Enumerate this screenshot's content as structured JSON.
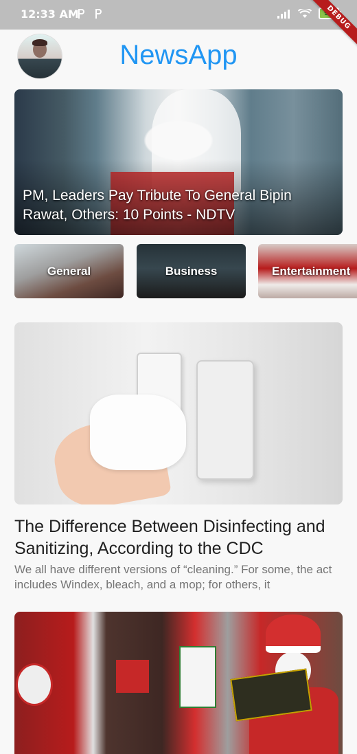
{
  "status_bar": {
    "time": "12:33 AM",
    "notification_icons": [
      "p-icon",
      "p-icon"
    ],
    "battery": "92",
    "debug_banner": "DEBUG"
  },
  "app_bar": {
    "title": "NewsApp",
    "title_color": "#2196f3"
  },
  "carousel": {
    "headline": "PM, Leaders Pay Tribute To General Bipin Rawat, Others: 10 Points - NDTV"
  },
  "categories": [
    {
      "label": "General"
    },
    {
      "label": "Business"
    },
    {
      "label": "Entertainment"
    }
  ],
  "articles": [
    {
      "title": "The Difference Between Disinfecting and Sanitizing, According to the CDC",
      "description": "We all have different versions of “cleaning.” For some, the act includes Windex, bleach, and a mop; for others, it"
    },
    {
      "title": "",
      "description": ""
    }
  ]
}
